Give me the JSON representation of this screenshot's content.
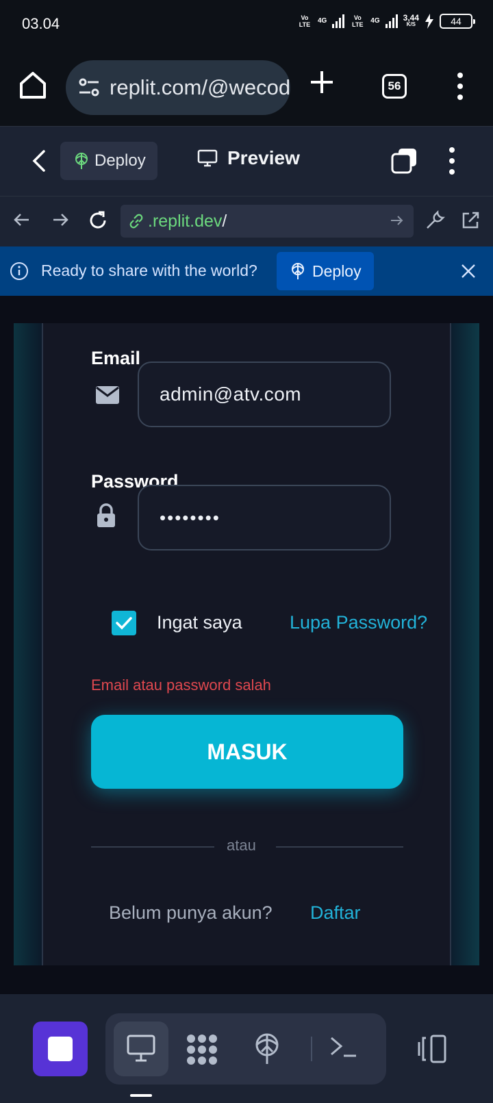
{
  "status": {
    "time": "03.04",
    "sim1_type": "Vo LTE",
    "sim1_network": "4G",
    "sim2_type": "Vo LTE",
    "sim2_network": "4G",
    "speed_value": "3,44",
    "speed_unit": "K/S",
    "battery": "44"
  },
  "browser": {
    "url": "replit.com/@wecoding",
    "tab_count": "56"
  },
  "replit_header": {
    "deploy_label": "Deploy",
    "preview_label": "Preview"
  },
  "webview": {
    "address_domain": ".replit.dev",
    "address_path": "/"
  },
  "banner": {
    "message": "Ready to share with the world?",
    "deploy_label": "Deploy"
  },
  "login": {
    "email_label": "Email",
    "email_value": "admin@atv.com",
    "password_label": "Password",
    "password_mask": "••••••••",
    "remember_label": "Ingat saya",
    "remember_checked": true,
    "forgot_label": "Lupa Password?",
    "error_text": "Email atau password salah",
    "submit_label": "MASUK",
    "divider_text": "atau",
    "signup_question": "Belum punya akun?",
    "signup_link": "Daftar"
  },
  "icons": {
    "home": "home-icon",
    "site_settings": "tune-icon",
    "new_tab": "plus-icon",
    "tabs": "tab-count-icon",
    "menu": "more-vertical-icon",
    "deploy": "deploy-icon",
    "preview": "monitor-icon",
    "email_field": "envelope-icon",
    "password_field": "lock-icon"
  },
  "colors": {
    "accent": "#06b6d4",
    "link": "#22b3d9",
    "error": "#e0484f",
    "banner": "#004182",
    "stop": "#5733d6"
  }
}
